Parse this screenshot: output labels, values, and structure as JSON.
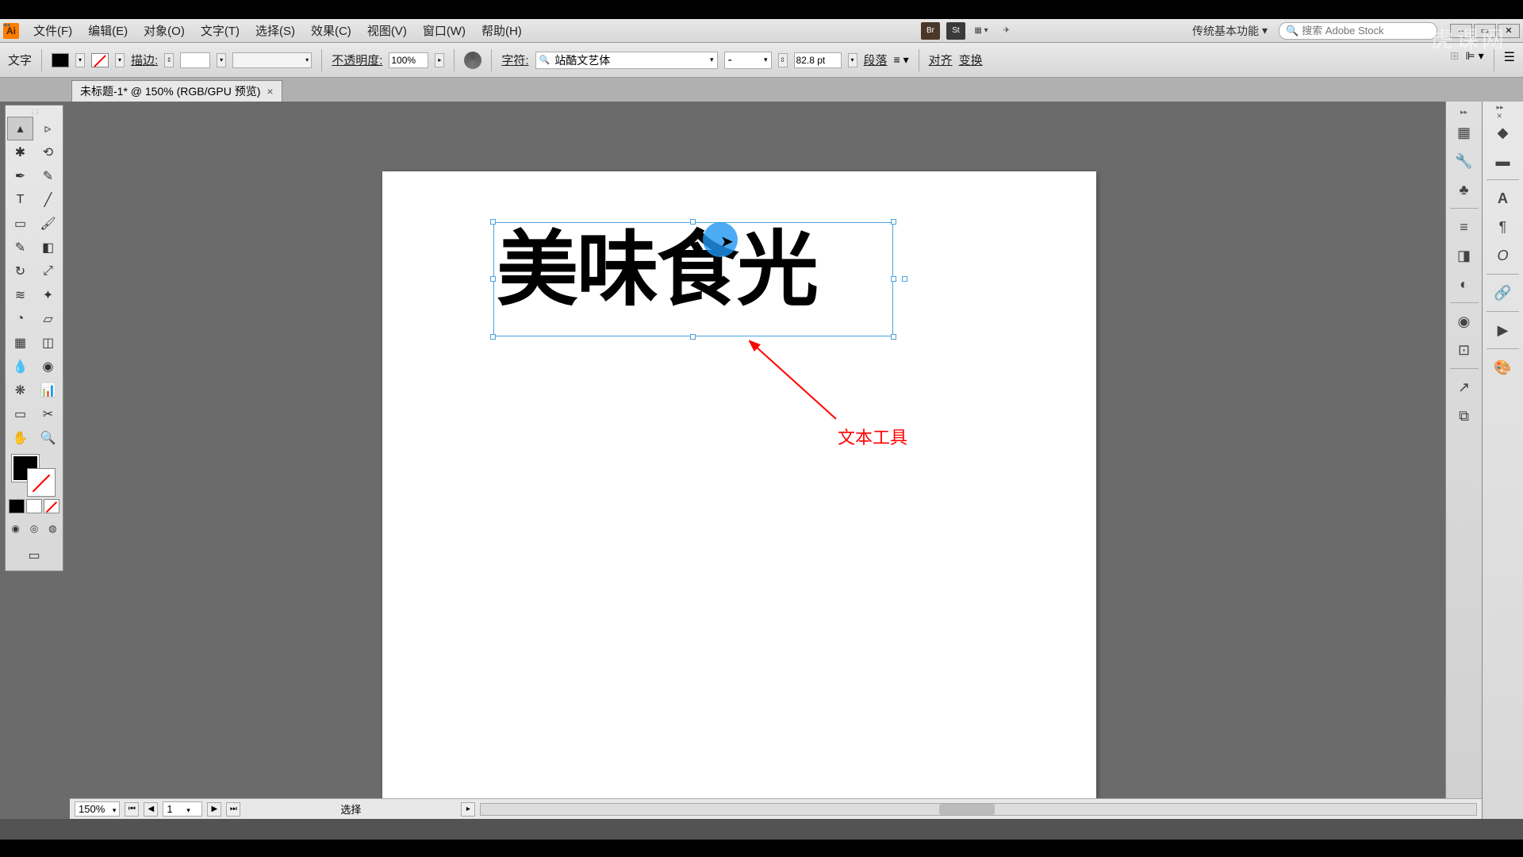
{
  "menu": {
    "file": "文件(F)",
    "edit": "编辑(E)",
    "object": "对象(O)",
    "type": "文字(T)",
    "select": "选择(S)",
    "effect": "效果(C)",
    "view": "视图(V)",
    "window": "窗口(W)",
    "help": "帮助(H)"
  },
  "titlebar": {
    "logo": "Ai",
    "bridge": "Br",
    "stock": "St",
    "workspace": "传统基本功能",
    "search_placeholder": "搜索 Adobe Stock"
  },
  "controlbar": {
    "panel_label": "文字",
    "stroke_label": "描边:",
    "opacity_label": "不透明度:",
    "opacity_value": "100%",
    "char_label": "字符:",
    "font_family": "站酷文艺体",
    "font_style": "-",
    "font_size": "82.8 pt",
    "paragraph": "段落",
    "align": "对齐",
    "transform": "变换"
  },
  "document": {
    "tab_title": "未标题-1* @ 150% (RGB/GPU 预览)"
  },
  "canvas": {
    "text_content": "美味食光",
    "annotation": "文本工具"
  },
  "statusbar": {
    "zoom": "150%",
    "page": "1",
    "mode": "选择"
  },
  "watermark": "虎课网"
}
